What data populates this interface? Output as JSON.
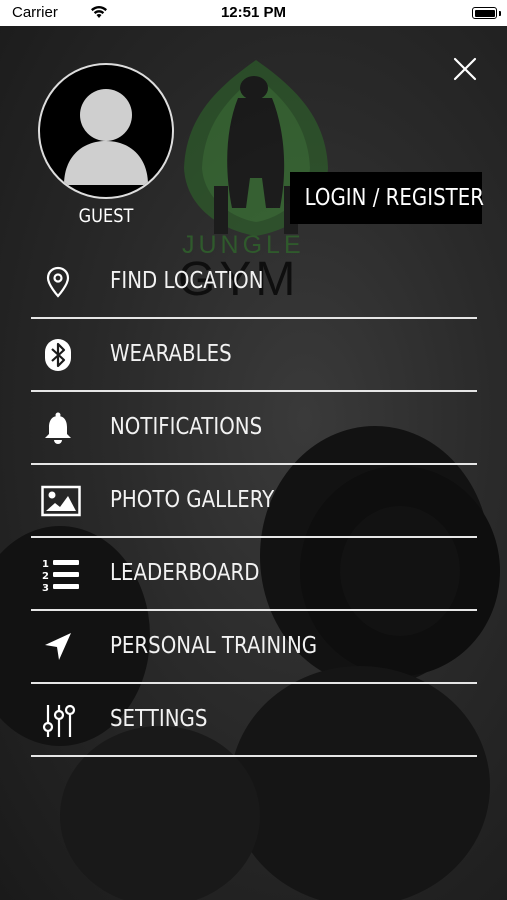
{
  "status_bar": {
    "carrier": "Carrier",
    "time": "12:51 PM"
  },
  "logo": {
    "line1": "JUNGLE",
    "line2": "GYM",
    "accent_color": "#3e7d38"
  },
  "profile": {
    "name": "GUEST",
    "login_label": "LOGIN / REGISTER"
  },
  "menu": {
    "items": [
      {
        "label": "FIND LOCATION",
        "icon": "location-pin-icon"
      },
      {
        "label": "WEARABLES",
        "icon": "bluetooth-icon"
      },
      {
        "label": "NOTIFICATIONS",
        "icon": "bell-icon"
      },
      {
        "label": "PHOTO GALLERY",
        "icon": "photo-icon"
      },
      {
        "label": "LEADERBOARD",
        "icon": "ranked-list-icon"
      },
      {
        "label": "PERSONAL TRAINING",
        "icon": "navigation-arrow-icon"
      },
      {
        "label": "SETTINGS",
        "icon": "sliders-icon"
      }
    ]
  },
  "colors": {
    "overlay": "#2a2a2a",
    "divider": "#e6e6e6",
    "text": "#ffffff"
  }
}
